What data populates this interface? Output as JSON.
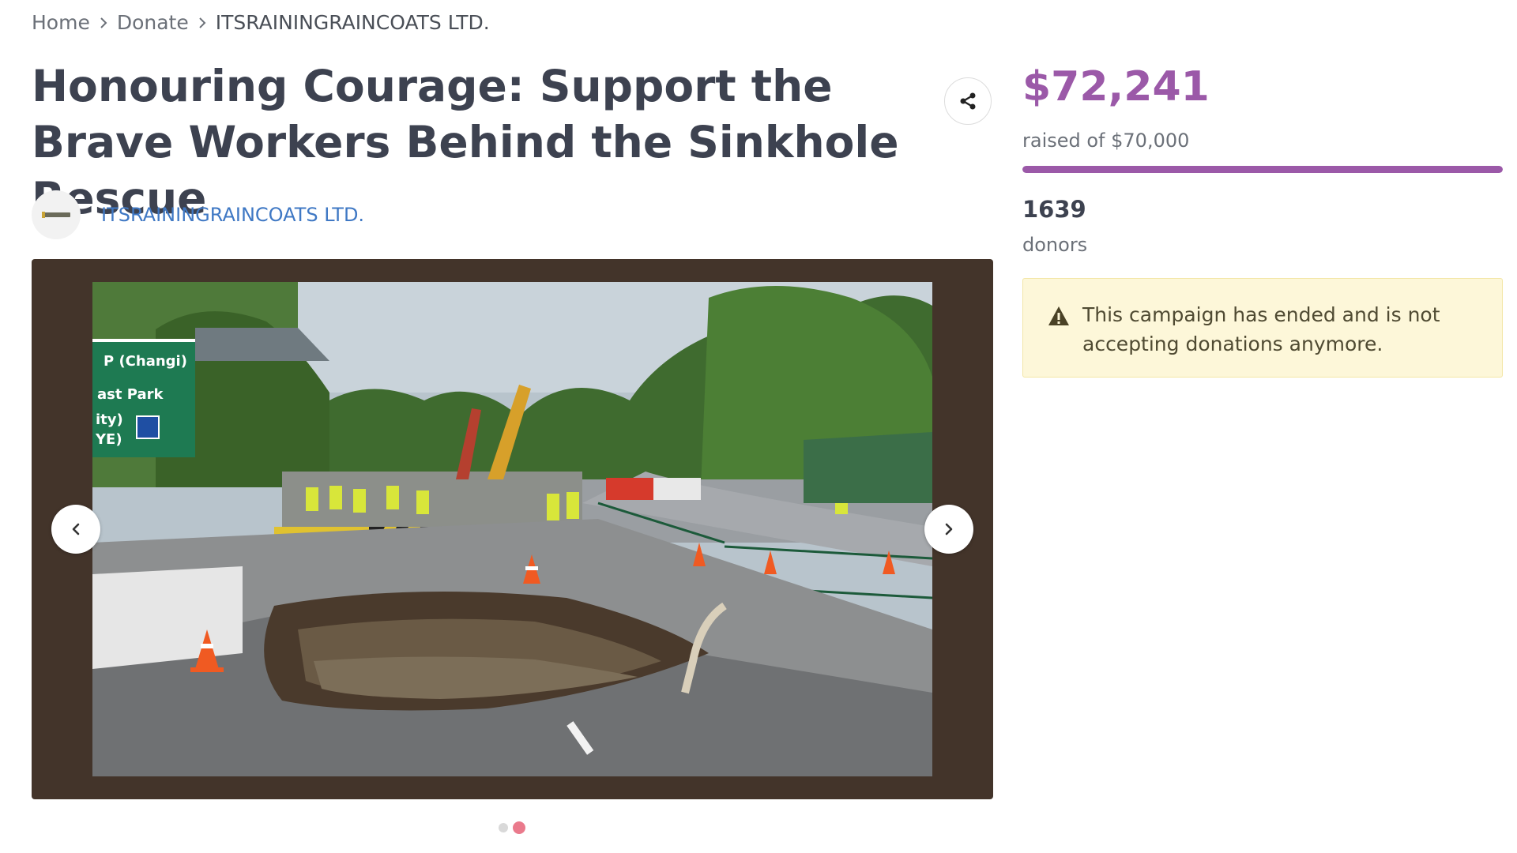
{
  "breadcrumb": {
    "items": [
      "Home",
      "Donate"
    ],
    "current": "ITSRAININGRAINCOATS LTD."
  },
  "campaign": {
    "title": "Honouring Courage: Support the Brave Workers Behind the Sinkhole Rescue",
    "organizer": "ITSRAININGRAINCOATS LTD."
  },
  "gallery": {
    "slide_count": 2,
    "active_slide": 2
  },
  "funding": {
    "amount_raised": "$72,241",
    "goal_text": "raised of $70,000",
    "progress_fraction": 1.0,
    "donor_count": "1639",
    "donor_label": "donors"
  },
  "notice": {
    "text": "This campaign has ended and is not accepting donations anymore."
  },
  "colors": {
    "accent": "#9b59a8",
    "link": "#3f78c4",
    "notice_bg": "#fdf7d9",
    "active_dot": "#ea7a8c",
    "gallery_bg": "#43342a"
  },
  "icons": {
    "share": "share-icon",
    "prev": "chevron-left-icon",
    "next": "chevron-right-icon",
    "warning": "warning-icon",
    "breadcrumb_sep": "chevron-right-icon"
  }
}
